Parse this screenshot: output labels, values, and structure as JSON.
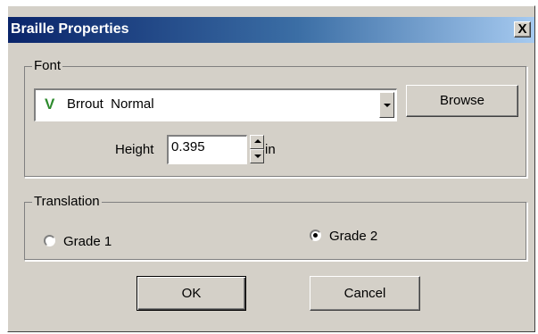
{
  "window": {
    "title": "Braille Properties",
    "close_glyph": "X"
  },
  "font_group": {
    "label": "Font",
    "font_icon_glyph": "V",
    "font_value": "Brrout  Normal",
    "browse_label": "Browse",
    "height_label": "Height",
    "height_value": "0.395",
    "unit_label": "in"
  },
  "translation_group": {
    "label": "Translation",
    "options": [
      {
        "label": "Grade 1",
        "selected": false
      },
      {
        "label": "Grade 2",
        "selected": true
      }
    ]
  },
  "actions": {
    "ok_label": "OK",
    "cancel_label": "Cancel"
  },
  "colors": {
    "titlebar_start": "#0a246a",
    "titlebar_end": "#a6caf0",
    "face": "#d4d0c8",
    "font_icon": "#2e8b2e"
  }
}
